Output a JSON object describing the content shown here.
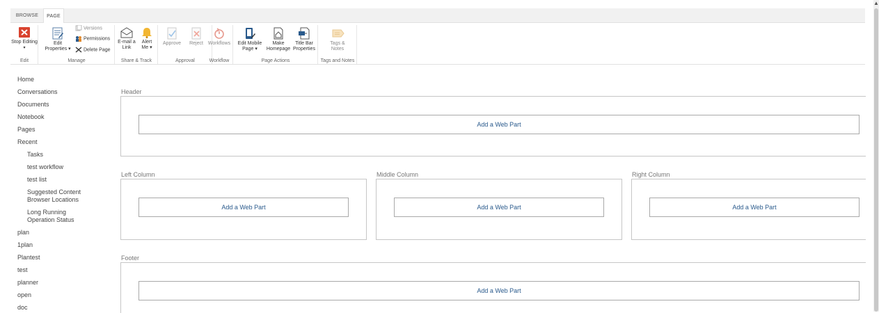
{
  "ribbon_tabs": {
    "browse": "BROWSE",
    "page": "PAGE"
  },
  "ribbon": {
    "edit": {
      "stop_editing": "Stop Editing",
      "label": "Edit"
    },
    "manage": {
      "edit_properties_1": "Edit",
      "edit_properties_2": "Properties ▾",
      "versions": "Versions",
      "permissions": "Permissions",
      "delete_page": "Delete Page",
      "label": "Manage"
    },
    "share": {
      "email_1": "E-mail a",
      "email_2": "Link",
      "alert_1": "Alert",
      "alert_2": "Me ▾",
      "label": "Share & Track"
    },
    "approval": {
      "approve": "Approve",
      "reject": "Reject",
      "label": "Approval"
    },
    "workflow": {
      "workflows": "Workflows",
      "label": "Workflow"
    },
    "page_actions": {
      "edit_mobile_1": "Edit Mobile",
      "edit_mobile_2": "Page ▾",
      "make_home_1": "Make",
      "make_home_2": "Homepage",
      "title_bar_1": "Title Bar",
      "title_bar_2": "Properties",
      "label": "Page Actions"
    },
    "tags": {
      "tags_1": "Tags &",
      "tags_2": "Notes",
      "label": "Tags and Notes"
    }
  },
  "nav": {
    "items": [
      "Home",
      "Conversations",
      "Documents",
      "Notebook",
      "Pages",
      "Recent"
    ],
    "recent": [
      "Tasks",
      "test workflow",
      "test list",
      "Suggested Content",
      "Browser Locations",
      "Long Running",
      "Operation Status"
    ],
    "more": [
      "plan",
      "1plan",
      "Plantest",
      "test",
      "planner",
      "open",
      "doc"
    ]
  },
  "zones": {
    "header": "Header",
    "left": "Left Column",
    "middle": "Middle Column",
    "right": "Right Column",
    "footer": "Footer",
    "add_web_part": "Add a Web Part"
  },
  "colors": {
    "accent_link": "#2a5a8c",
    "stop_editing_red": "#d9432f",
    "alert_bell": "#f2b632"
  },
  "icons": {
    "stop_editing": "stop-editing-icon",
    "edit_properties": "edit-properties-icon",
    "versions": "versions-icon",
    "permissions": "permissions-icon",
    "delete_page": "delete-icon",
    "email": "email-icon",
    "alert": "bell-icon",
    "approve": "approve-icon",
    "reject": "reject-icon",
    "workflows": "workflows-icon",
    "edit_mobile": "edit-mobile-icon",
    "make_homepage": "homepage-icon",
    "title_bar": "title-bar-icon",
    "tags": "tags-icon"
  }
}
